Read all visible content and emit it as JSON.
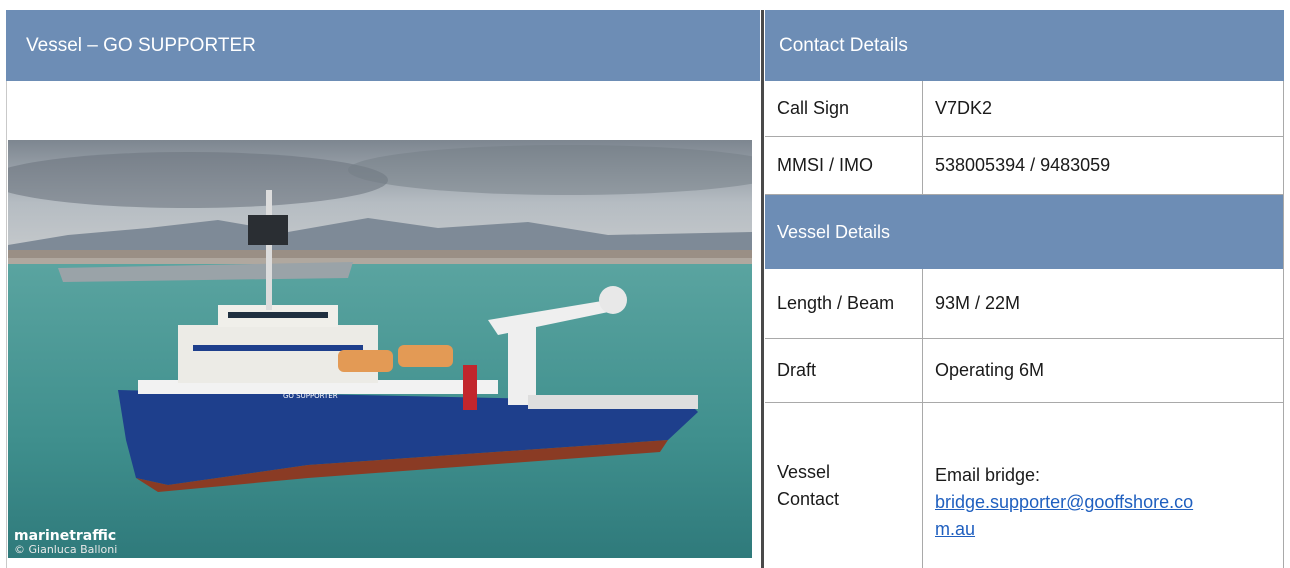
{
  "header": {
    "vessel_title": "Vessel – GO SUPPORTER",
    "contact_title": "Contact Details"
  },
  "contact": {
    "rows": [
      {
        "label": "Call Sign",
        "value": "V7DK2"
      },
      {
        "label": "MMSI / IMO",
        "value": "538005394 / 9483059"
      }
    ]
  },
  "vessel_details": {
    "title": "Vessel Details",
    "rows": [
      {
        "label": "Length / Beam",
        "value": "93M / 22M"
      },
      {
        "label": "Draft",
        "value": "Operating 6M"
      }
    ],
    "contact_row": {
      "label_line1": "Vessel",
      "label_line2": "Contact",
      "email_label": "Email bridge:",
      "email_part1": "bridge.supporter@gooffshore.co",
      "email_part2": "m.au"
    }
  },
  "photo": {
    "watermark_brand": "marinetraffic",
    "watermark_credit": "© Gianluca Balloni",
    "hull_name": "GO SUPPORTER"
  },
  "colors": {
    "header_bg": "#6d8db5",
    "link": "#1f5fbf",
    "hull_blue": "#1e3f8c",
    "sea": "#4e9b98"
  }
}
